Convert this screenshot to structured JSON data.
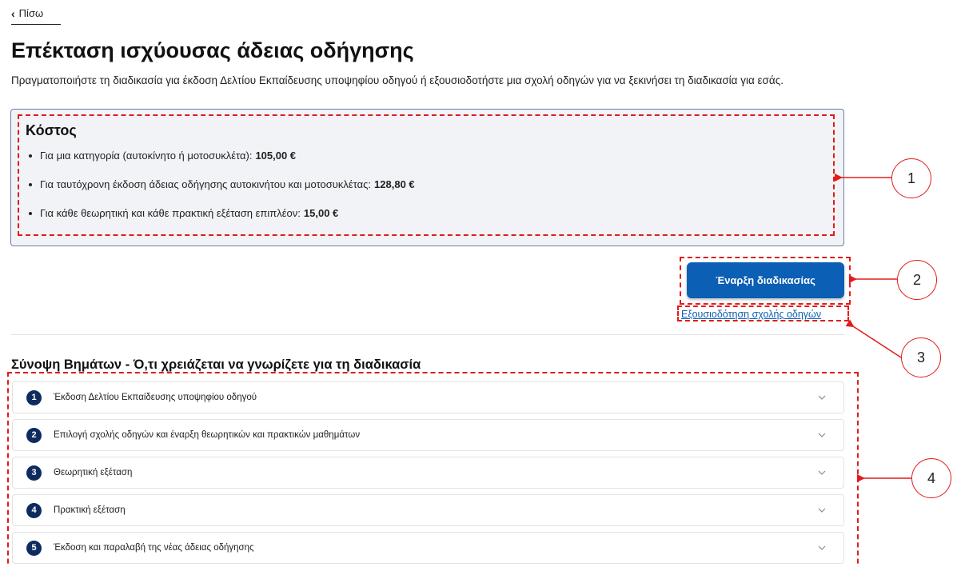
{
  "nav": {
    "back_label": "Πίσω"
  },
  "page": {
    "title": "Επέκταση ισχύουσας άδειας οδήγησης",
    "intro": "Πραγματοποιήστε τη διαδικασία για έκδοση Δελτίου Εκπαίδευσης υποψηφίου οδηγού ή εξουσιοδοτήστε μια σχολή οδηγών για να ξεκινήσει τη διαδικασία για εσάς."
  },
  "cost": {
    "title": "Κόστος",
    "items": [
      {
        "text": "Για μια κατηγορία (αυτοκίνητο ή μοτοσυκλέτα):",
        "amount": "105,00 €"
      },
      {
        "text": "Για ταυτόχρονη έκδοση άδειας οδήγησης αυτοκινήτου και μοτοσυκλέτας:",
        "amount": "128,80 €"
      },
      {
        "text": "Για κάθε θεωρητική και κάθε πρακτική εξέταση επιπλέον:",
        "amount": "15,00 €"
      }
    ]
  },
  "actions": {
    "start_label": "Έναρξη διαδικασίας",
    "authorize_label": "Εξουσιοδότηση σχολής οδηγών"
  },
  "steps": {
    "title": "Σύνοψη Βημάτων - Ό,τι χρειάζεται να γνωρίζετε για τη διαδικασία",
    "items": [
      {
        "num": "1",
        "label": "Έκδοση Δελτίου Εκπαίδευσης υποψηφίου οδηγού"
      },
      {
        "num": "2",
        "label": "Επιλογή σχολής οδηγών και έναρξη θεωρητικών και πρακτικών μαθημάτων"
      },
      {
        "num": "3",
        "label": "Θεωρητική εξέταση"
      },
      {
        "num": "4",
        "label": "Πρακτική εξέταση"
      },
      {
        "num": "5",
        "label": "Έκδοση και παραλαβή της νέας άδειας οδήγησης"
      }
    ]
  },
  "annotations": [
    "1",
    "2",
    "3",
    "4"
  ],
  "colors": {
    "primary": "#0b5fb4",
    "step_badge": "#0d2b5e",
    "annotation": "#e21b1b",
    "cost_bg": "#f1f3f7"
  }
}
